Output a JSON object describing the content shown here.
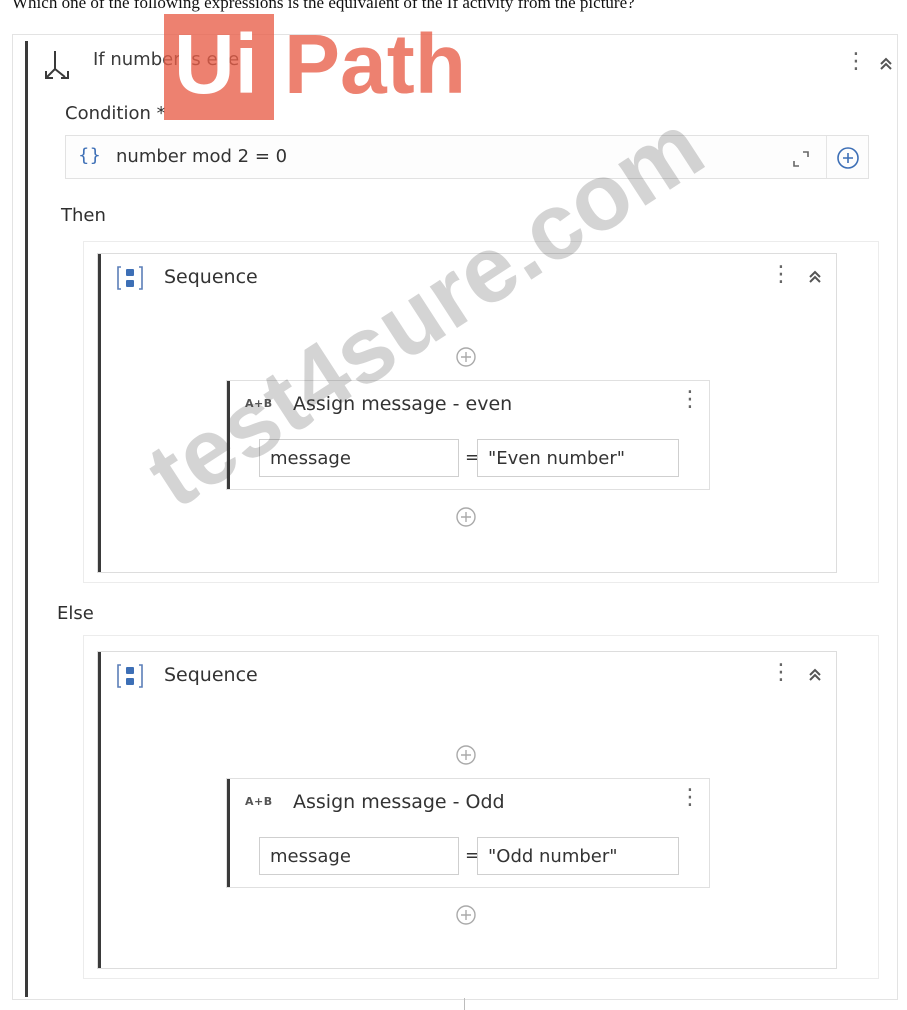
{
  "question": "Which one of the following expressions is the equivalent of the If activity from the picture?",
  "if_activity": {
    "title": "If number is even",
    "condition_label": "Condition *",
    "condition_braces": "{}",
    "condition": "number mod 2 = 0",
    "then_label": "Then",
    "else_label": "Else"
  },
  "then_sequence": {
    "title": "Sequence",
    "assign": {
      "icon_text": "A+B",
      "title": "Assign message - even",
      "to": "message",
      "equals": "=",
      "value": "\"Even number\""
    }
  },
  "else_sequence": {
    "title": "Sequence",
    "assign": {
      "icon_text": "A+B",
      "title": "Assign message - Odd",
      "to": "message",
      "equals": "=",
      "value": "\"Odd number\""
    }
  },
  "watermarks": {
    "logo_part1": "Ui",
    "logo_part2": "Path",
    "site": "test4sure.com"
  },
  "colors": {
    "accent_blue": "#3d6fb6",
    "rail": "#3a3a3a",
    "watermark_orange": "#e85e48"
  },
  "icons": {
    "if": "branch-arrow-icon",
    "sequence": "sequence-icon",
    "assign": "assign-icon",
    "expand": "expand-icon",
    "add": "add-circle-icon",
    "menu": "more-vertical-icon",
    "collapse": "chevron-double-up-icon"
  }
}
